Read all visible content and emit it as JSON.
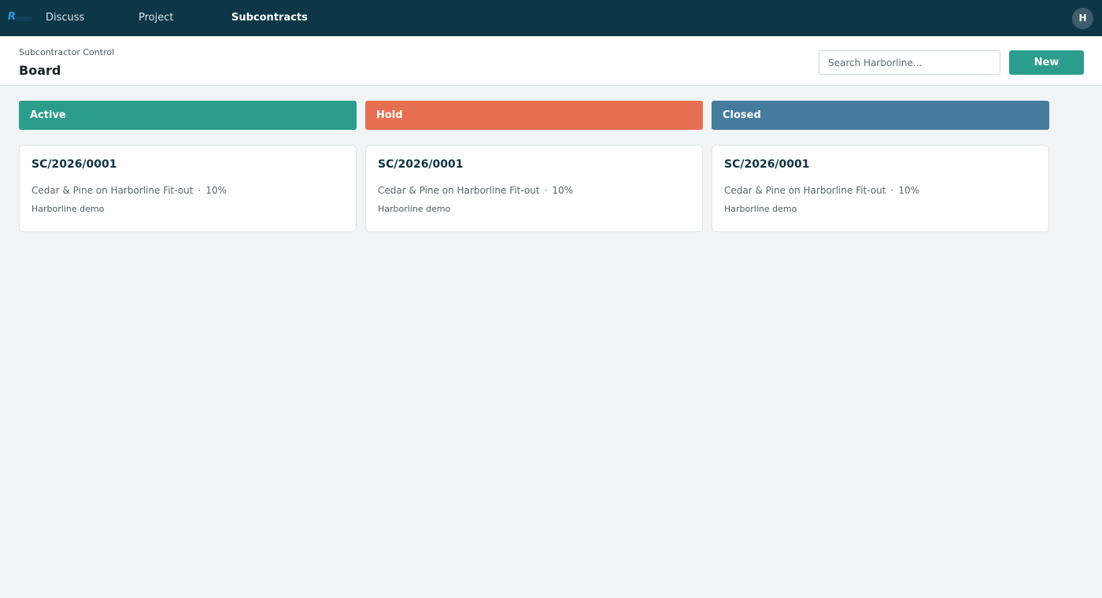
{
  "nav": {
    "items": [
      {
        "label": "Discuss",
        "active": false
      },
      {
        "label": "Project",
        "active": false
      },
      {
        "label": "Subcontracts",
        "active": true
      }
    ],
    "user_initial": "H"
  },
  "header": {
    "breadcrumb": "Subcontractor Control",
    "title": "Board",
    "search_placeholder": "Search Harborline...",
    "new_label": "New"
  },
  "board": {
    "columns": [
      {
        "label": "Active",
        "color": "#2a9d8c",
        "cards": [
          {
            "id": "SC/2026/0001",
            "vendor": "Cedar & Pine on Harborline Fit-out",
            "retention": "10%",
            "project": "Harborline demo"
          }
        ]
      },
      {
        "label": "Hold",
        "color": "#e76f51",
        "cards": [
          {
            "id": "SC/2026/0001",
            "vendor": "Cedar & Pine on Harborline Fit-out",
            "retention": "10%",
            "project": "Harborline demo"
          }
        ]
      },
      {
        "label": "Closed",
        "color": "#457b9d",
        "cards": [
          {
            "id": "SC/2026/0001",
            "vendor": "Cedar & Pine on Harborline Fit-out",
            "retention": "10%",
            "project": "Harborline demo"
          }
        ]
      }
    ]
  }
}
